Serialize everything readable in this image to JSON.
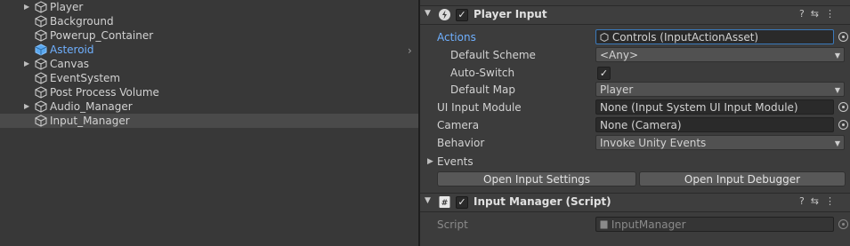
{
  "hierarchy": {
    "items": [
      {
        "label": "Player",
        "has_children": true,
        "selected": false,
        "active": false
      },
      {
        "label": "Background",
        "has_children": false,
        "selected": false,
        "active": false
      },
      {
        "label": "Powerup_Container",
        "has_children": false,
        "selected": false,
        "active": false
      },
      {
        "label": "Asteroid",
        "has_children": false,
        "selected": false,
        "active": true
      },
      {
        "label": "Canvas",
        "has_children": true,
        "selected": false,
        "active": false
      },
      {
        "label": "EventSystem",
        "has_children": false,
        "selected": false,
        "active": false
      },
      {
        "label": "Post Process Volume",
        "has_children": false,
        "selected": false,
        "active": false
      },
      {
        "label": "Audio_Manager",
        "has_children": true,
        "selected": false,
        "active": false
      },
      {
        "label": "Input_Manager",
        "has_children": false,
        "selected": true,
        "active": false
      }
    ]
  },
  "player_input": {
    "title": "Player Input",
    "enabled": true,
    "actions_label": "Actions",
    "actions_value": "Controls (InputActionAsset)",
    "default_scheme_label": "Default Scheme",
    "default_scheme_value": "<Any>",
    "auto_switch_label": "Auto-Switch",
    "auto_switch_checked": true,
    "check_glyph": "✓",
    "default_map_label": "Default Map",
    "default_map_value": "Player",
    "ui_input_module_label": "UI Input Module",
    "ui_input_module_value": "None (Input System UI Input Module)",
    "camera_label": "Camera",
    "camera_value": "None (Camera)",
    "behavior_label": "Behavior",
    "behavior_value": "Invoke Unity Events",
    "events_label": "Events",
    "open_settings_button": "Open Input Settings",
    "open_debugger_button": "Open Input Debugger"
  },
  "input_manager": {
    "title": "Input Manager (Script)",
    "enabled": true,
    "script_label": "Script",
    "script_value": "InputManager"
  },
  "header_icons": [
    "help-icon",
    "presets-icon",
    "more-icon"
  ],
  "colors": {
    "accent_blue": "#6fb0ff",
    "selection": "#4a4a4a",
    "field_highlight": "#3a79bb"
  }
}
